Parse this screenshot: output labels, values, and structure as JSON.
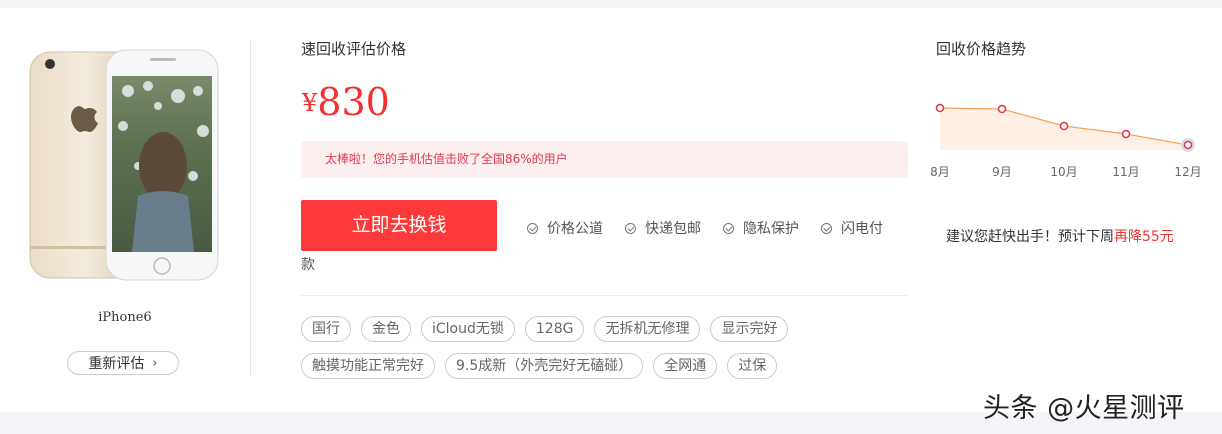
{
  "product": {
    "model": "iPhone6",
    "reeval_label": "重新评估"
  },
  "valuation": {
    "title": "速回收评估价格",
    "currency": "¥",
    "price": "830",
    "banner_text": "太棒啦！您的手机估值击败了全国86%的用户",
    "cta_label": "立即去换钱",
    "guarantees": [
      "价格公道",
      "快递包邮",
      "隐私保护",
      "闪电付"
    ],
    "guarantee_wrap": "款"
  },
  "tags": {
    "row1": [
      "国行",
      "金色",
      "iCloud无锁",
      "128G",
      "无拆机无修理",
      "显示完好"
    ],
    "row2": [
      "触摸功能正常完好",
      "9.5成新（外壳完好无磕碰）",
      "全网通",
      "过保"
    ]
  },
  "trend": {
    "title": "回收价格趋势",
    "advice_prefix": "建议您赶快出手！预计下周",
    "advice_highlight": "再降55元"
  },
  "chart_data": {
    "type": "line",
    "categories": [
      "8月",
      "9月",
      "10月",
      "11月",
      "12月"
    ],
    "values": [
      930,
      929,
      912,
      904,
      893
    ],
    "title": "回收价格趋势",
    "colors": {
      "line": "#f5a05a",
      "point": "#d9344a",
      "area": "#fde3cf"
    }
  },
  "watermark": "头条 @火星测评",
  "colors": {
    "accent": "#fe3a3a",
    "price": "#f23030",
    "banner_bg": "#fdeef0"
  }
}
